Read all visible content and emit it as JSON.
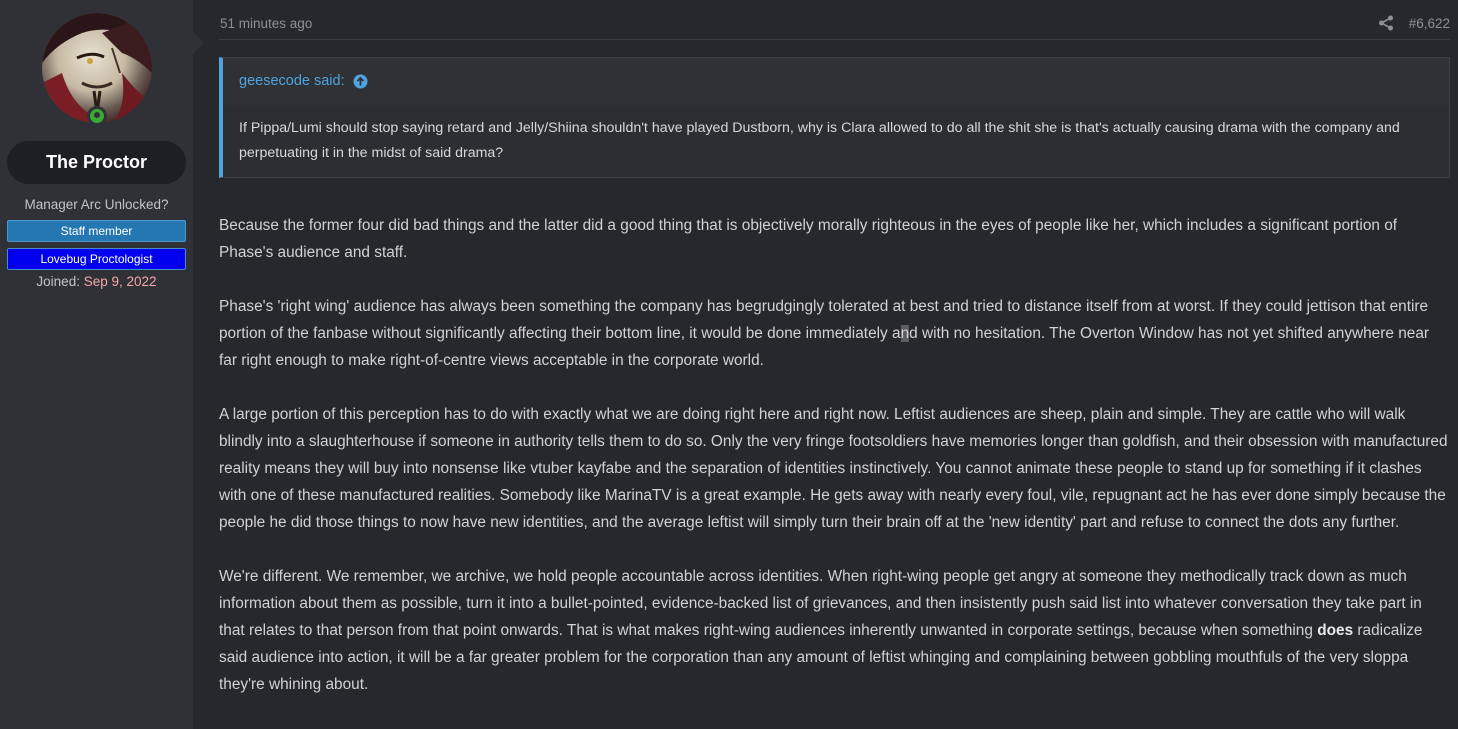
{
  "user": {
    "avatar_icon": "user-avatar",
    "username": "The Proctor",
    "user_title": "Manager Arc Unlocked?",
    "banners": [
      "Staff member",
      "Lovebug Proctologist"
    ],
    "joined_label": "Joined:",
    "joined_date": "Sep 9, 2022",
    "online_icon": "online-indicator-icon"
  },
  "post": {
    "timestamp": "51 minutes ago",
    "share_icon": "share-icon",
    "post_number": "#6,622"
  },
  "quote": {
    "author_said": "geesecode said:",
    "jump_icon": "arrow-up-circle-icon",
    "text": "If Pippa/Lumi should stop saying retard and Jelly/Shiina shouldn't have played Dustborn, why is Clara allowed to do all the shit she is that's actually causing drama with the company and perpetuating it in the midst of said drama?"
  },
  "body": {
    "p1": "Because the former four did bad things and the latter did a good thing that is objectively morally righteous in the eyes of people like her, which includes a significant portion of Phase's audience and staff.",
    "p2_a": "Phase's 'right wing' audience has always been something the company has begrudgingly tolerated at best and tried to distance itself from at worst. If they could jettison that entire portion of the fanbase without significantly affecting their bottom line, it would be done immediately a",
    "p2_hl": "n",
    "p2_b": "d with no hesitation. The Overton Window has not yet shifted anywhere near far right enough to make right-of-centre views acceptable in the corporate world.",
    "p3": "A large portion of this perception has to do with exactly what we are doing right here and right now. Leftist audiences are sheep, plain and simple. They are cattle who will walk blindly into a slaughterhouse if someone in authority tells them to do so. Only the very fringe footsoldiers have memories longer than goldfish, and their obsession with manufactured reality means they will buy into nonsense like vtuber kayfabe and the separation of identities instinctively. You cannot animate these people to stand up for something if it clashes with one of these manufactured realities. Somebody like MarinaTV is a great example. He gets away with nearly every foul, vile, repugnant act he has ever done simply because the people he did those things to now have new identities, and the average leftist will simply turn their brain off at the 'new identity' part and refuse to connect the dots any further.",
    "p4_a": "We're different. We remember, we archive, we hold people accountable across identities. When right-wing people get angry at someone they methodically track down as much information about them as possible, turn it into a bullet-pointed, evidence-backed list of grievances, and then insistently push said list into whatever conversation they take part in that relates to that person from that point onwards. That is what makes right-wing audiences inherently unwanted in corporate settings, because when something ",
    "p4_bold": "does",
    "p4_b": " radicalize said audience into action, it will be a far greater problem for the corporation than any amount of leftist whinging and complaining between gobbling mouthfuls of the very sloppa they're whining about."
  }
}
